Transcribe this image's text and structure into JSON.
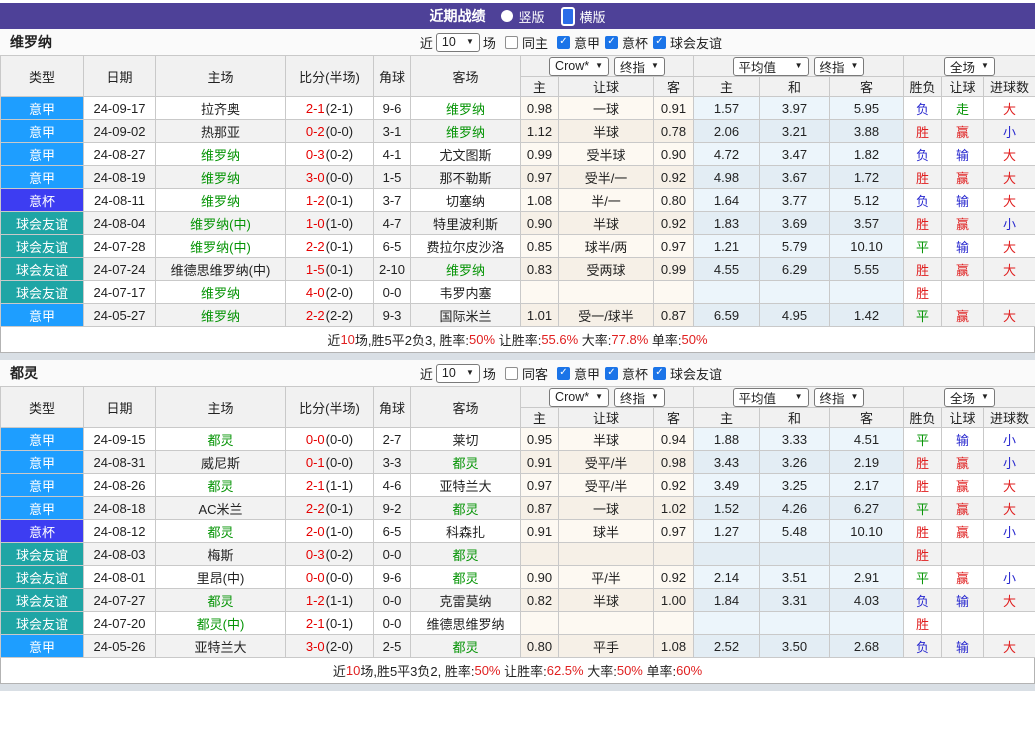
{
  "topbar": {
    "title": "近期战绩",
    "radios": [
      {
        "label": "竖版",
        "selected": false
      },
      {
        "label": "横版",
        "selected": true
      }
    ]
  },
  "table": {
    "left_headers": [
      "类型",
      "日期",
      "主场",
      "比分(半场)",
      "角球",
      "客场"
    ],
    "selects": {
      "crow": "Crow*",
      "fin1": "终指",
      "avg": "平均值",
      "fin2": "终指",
      "full": "全场"
    },
    "sub_headers": [
      "主",
      "让球",
      "客",
      "主",
      "和",
      "客",
      "胜负",
      "让球",
      "进球数"
    ]
  },
  "colors": {
    "topbar_bg": "#4e4198",
    "league": {
      "意甲": "#1e9eff",
      "意杯": "#3d3df2",
      "球会友谊": "#1fa5a5"
    },
    "result": {
      "r": "#e01f1f",
      "g": "#059405",
      "b": "#2828cf",
      "k": "#222222"
    },
    "team_highlight": "#059405",
    "score_ft": "#e60000",
    "score_ht": "#222222",
    "avg_col_bg": "#ecf5fb",
    "crow_col_bg": "#fdf9f2"
  },
  "teams": [
    {
      "name": "维罗纳",
      "controls": {
        "prefix": "近",
        "count": "10",
        "suffix": "场",
        "same_label": "同主",
        "same_checked": false,
        "filters": [
          {
            "label": "意甲",
            "checked": true
          },
          {
            "label": "意杯",
            "checked": true
          },
          {
            "label": "球会友谊",
            "checked": true
          }
        ]
      },
      "rows": [
        {
          "type": "意甲",
          "date": "24-09-17",
          "home": "拉齐奥",
          "home_hl": false,
          "ft": "2-1",
          "ht": "(2-1)",
          "corner": "9-6",
          "away": "维罗纳",
          "away_hl": true,
          "crow": [
            "0.98",
            "一球",
            "0.91"
          ],
          "avg": [
            "1.57",
            "3.97",
            "5.95"
          ],
          "res": [
            [
              "负",
              "b"
            ],
            [
              "走",
              "g"
            ],
            [
              "大",
              "r"
            ]
          ]
        },
        {
          "type": "意甲",
          "date": "24-09-02",
          "home": "热那亚",
          "home_hl": false,
          "ft": "0-2",
          "ht": "(0-0)",
          "corner": "3-1",
          "away": "维罗纳",
          "away_hl": true,
          "crow": [
            "1.12",
            "半球",
            "0.78"
          ],
          "avg": [
            "2.06",
            "3.21",
            "3.88"
          ],
          "res": [
            [
              "胜",
              "r"
            ],
            [
              "赢",
              "r"
            ],
            [
              "小",
              "b"
            ]
          ]
        },
        {
          "type": "意甲",
          "date": "24-08-27",
          "home": "维罗纳",
          "home_hl": true,
          "ft": "0-3",
          "ht": "(0-2)",
          "corner": "4-1",
          "away": "尤文图斯",
          "away_hl": false,
          "crow": [
            "0.99",
            "受半球",
            "0.90"
          ],
          "avg": [
            "4.72",
            "3.47",
            "1.82"
          ],
          "res": [
            [
              "负",
              "b"
            ],
            [
              "输",
              "b"
            ],
            [
              "大",
              "r"
            ]
          ]
        },
        {
          "type": "意甲",
          "date": "24-08-19",
          "home": "维罗纳",
          "home_hl": true,
          "ft": "3-0",
          "ht": "(0-0)",
          "corner": "1-5",
          "away": "那不勒斯",
          "away_hl": false,
          "crow": [
            "0.97",
            "受半/一",
            "0.92"
          ],
          "avg": [
            "4.98",
            "3.67",
            "1.72"
          ],
          "res": [
            [
              "胜",
              "r"
            ],
            [
              "赢",
              "r"
            ],
            [
              "大",
              "r"
            ]
          ]
        },
        {
          "type": "意杯",
          "date": "24-08-11",
          "home": "维罗纳",
          "home_hl": true,
          "ft": "1-2",
          "ht": "(0-1)",
          "corner": "3-7",
          "away": "切塞纳",
          "away_hl": false,
          "crow": [
            "1.08",
            "半/一",
            "0.80"
          ],
          "avg": [
            "1.64",
            "3.77",
            "5.12"
          ],
          "res": [
            [
              "负",
              "b"
            ],
            [
              "输",
              "b"
            ],
            [
              "大",
              "r"
            ]
          ]
        },
        {
          "type": "球会友谊",
          "date": "24-08-04",
          "home": "维罗纳(中)",
          "home_hl": true,
          "ft": "1-0",
          "ht": "(1-0)",
          "corner": "4-7",
          "away": "特里波利斯",
          "away_hl": false,
          "crow": [
            "0.90",
            "半球",
            "0.92"
          ],
          "avg": [
            "1.83",
            "3.69",
            "3.57"
          ],
          "res": [
            [
              "胜",
              "r"
            ],
            [
              "赢",
              "r"
            ],
            [
              "小",
              "b"
            ]
          ]
        },
        {
          "type": "球会友谊",
          "date": "24-07-28",
          "home": "维罗纳(中)",
          "home_hl": true,
          "ft": "2-2",
          "ht": "(0-1)",
          "corner": "6-5",
          "away": "费拉尔皮沙洛",
          "away_hl": false,
          "crow": [
            "0.85",
            "球半/两",
            "0.97"
          ],
          "avg": [
            "1.21",
            "5.79",
            "10.10"
          ],
          "res": [
            [
              "平",
              "g"
            ],
            [
              "输",
              "b"
            ],
            [
              "大",
              "r"
            ]
          ]
        },
        {
          "type": "球会友谊",
          "date": "24-07-24",
          "home": "维德思维罗纳(中)",
          "home_hl": false,
          "ft": "1-5",
          "ht": "(0-1)",
          "corner": "2-10",
          "away": "维罗纳",
          "away_hl": true,
          "crow": [
            "0.83",
            "受两球",
            "0.99"
          ],
          "avg": [
            "4.55",
            "6.29",
            "5.55"
          ],
          "res": [
            [
              "胜",
              "r"
            ],
            [
              "赢",
              "r"
            ],
            [
              "大",
              "r"
            ]
          ]
        },
        {
          "type": "球会友谊",
          "date": "24-07-17",
          "home": "维罗纳",
          "home_hl": true,
          "ft": "4-0",
          "ht": "(2-0)",
          "corner": "0-0",
          "away": "韦罗内塞",
          "away_hl": false,
          "crow": [
            "",
            "",
            ""
          ],
          "avg": [
            "",
            "",
            ""
          ],
          "res": [
            [
              "胜",
              "r"
            ],
            [
              "",
              ""
            ],
            [
              "",
              ""
            ]
          ]
        },
        {
          "type": "意甲",
          "date": "24-05-27",
          "home": "维罗纳",
          "home_hl": true,
          "ft": "2-2",
          "ht": "(2-2)",
          "corner": "9-3",
          "away": "国际米兰",
          "away_hl": false,
          "crow": [
            "1.01",
            "受一/球半",
            "0.87"
          ],
          "avg": [
            "6.59",
            "4.95",
            "1.42"
          ],
          "res": [
            [
              "平",
              "g"
            ],
            [
              "赢",
              "r"
            ],
            [
              "大",
              "r"
            ]
          ]
        }
      ],
      "summary": [
        [
          "近",
          "k"
        ],
        [
          "10",
          "r"
        ],
        [
          "场,胜5平2负3, 胜率:",
          "k"
        ],
        [
          "50%",
          "r"
        ],
        [
          " 让胜率:",
          "k"
        ],
        [
          "55.6%",
          "r"
        ],
        [
          " 大率:",
          "k"
        ],
        [
          "77.8%",
          "r"
        ],
        [
          " 单率:",
          "k"
        ],
        [
          "50%",
          "r"
        ]
      ]
    },
    {
      "name": "都灵",
      "controls": {
        "prefix": "近",
        "count": "10",
        "suffix": "场",
        "same_label": "同客",
        "same_checked": false,
        "filters": [
          {
            "label": "意甲",
            "checked": true
          },
          {
            "label": "意杯",
            "checked": true
          },
          {
            "label": "球会友谊",
            "checked": true
          }
        ]
      },
      "rows": [
        {
          "type": "意甲",
          "date": "24-09-15",
          "home": "都灵",
          "home_hl": true,
          "ft": "0-0",
          "ht": "(0-0)",
          "corner": "2-7",
          "away": "莱切",
          "away_hl": false,
          "crow": [
            "0.95",
            "半球",
            "0.94"
          ],
          "avg": [
            "1.88",
            "3.33",
            "4.51"
          ],
          "res": [
            [
              "平",
              "g"
            ],
            [
              "输",
              "b"
            ],
            [
              "小",
              "b"
            ]
          ]
        },
        {
          "type": "意甲",
          "date": "24-08-31",
          "home": "威尼斯",
          "home_hl": false,
          "ft": "0-1",
          "ht": "(0-0)",
          "corner": "3-3",
          "away": "都灵",
          "away_hl": true,
          "crow": [
            "0.91",
            "受平/半",
            "0.98"
          ],
          "avg": [
            "3.43",
            "3.26",
            "2.19"
          ],
          "res": [
            [
              "胜",
              "r"
            ],
            [
              "赢",
              "r"
            ],
            [
              "小",
              "b"
            ]
          ]
        },
        {
          "type": "意甲",
          "date": "24-08-26",
          "home": "都灵",
          "home_hl": true,
          "ft": "2-1",
          "ht": "(1-1)",
          "corner": "4-6",
          "away": "亚特兰大",
          "away_hl": false,
          "crow": [
            "0.97",
            "受平/半",
            "0.92"
          ],
          "avg": [
            "3.49",
            "3.25",
            "2.17"
          ],
          "res": [
            [
              "胜",
              "r"
            ],
            [
              "赢",
              "r"
            ],
            [
              "大",
              "r"
            ]
          ]
        },
        {
          "type": "意甲",
          "date": "24-08-18",
          "home": "AC米兰",
          "home_hl": false,
          "ft": "2-2",
          "ht": "(0-1)",
          "corner": "9-2",
          "away": "都灵",
          "away_hl": true,
          "crow": [
            "0.87",
            "一球",
            "1.02"
          ],
          "avg": [
            "1.52",
            "4.26",
            "6.27"
          ],
          "res": [
            [
              "平",
              "g"
            ],
            [
              "赢",
              "r"
            ],
            [
              "大",
              "r"
            ]
          ]
        },
        {
          "type": "意杯",
          "date": "24-08-12",
          "home": "都灵",
          "home_hl": true,
          "ft": "2-0",
          "ht": "(1-0)",
          "corner": "6-5",
          "away": "科森扎",
          "away_hl": false,
          "crow": [
            "0.91",
            "球半",
            "0.97"
          ],
          "avg": [
            "1.27",
            "5.48",
            "10.10"
          ],
          "res": [
            [
              "胜",
              "r"
            ],
            [
              "赢",
              "r"
            ],
            [
              "小",
              "b"
            ]
          ]
        },
        {
          "type": "球会友谊",
          "date": "24-08-03",
          "home": "梅斯",
          "home_hl": false,
          "ft": "0-3",
          "ht": "(0-2)",
          "corner": "0-0",
          "away": "都灵",
          "away_hl": true,
          "crow": [
            "",
            "",
            ""
          ],
          "avg": [
            "",
            "",
            ""
          ],
          "res": [
            [
              "胜",
              "r"
            ],
            [
              "",
              ""
            ],
            [
              "",
              ""
            ]
          ]
        },
        {
          "type": "球会友谊",
          "date": "24-08-01",
          "home": "里昂(中)",
          "home_hl": false,
          "ft": "0-0",
          "ht": "(0-0)",
          "corner": "9-6",
          "away": "都灵",
          "away_hl": true,
          "crow": [
            "0.90",
            "平/半",
            "0.92"
          ],
          "avg": [
            "2.14",
            "3.51",
            "2.91"
          ],
          "res": [
            [
              "平",
              "g"
            ],
            [
              "赢",
              "r"
            ],
            [
              "小",
              "b"
            ]
          ]
        },
        {
          "type": "球会友谊",
          "date": "24-07-27",
          "home": "都灵",
          "home_hl": true,
          "ft": "1-2",
          "ht": "(1-1)",
          "corner": "0-0",
          "away": "克雷莫纳",
          "away_hl": false,
          "crow": [
            "0.82",
            "半球",
            "1.00"
          ],
          "avg": [
            "1.84",
            "3.31",
            "4.03"
          ],
          "res": [
            [
              "负",
              "b"
            ],
            [
              "输",
              "b"
            ],
            [
              "大",
              "r"
            ]
          ]
        },
        {
          "type": "球会友谊",
          "date": "24-07-20",
          "home": "都灵(中)",
          "home_hl": true,
          "ft": "2-1",
          "ht": "(0-1)",
          "corner": "0-0",
          "away": "维德思维罗纳",
          "away_hl": false,
          "crow": [
            "",
            "",
            ""
          ],
          "avg": [
            "",
            "",
            ""
          ],
          "res": [
            [
              "胜",
              "r"
            ],
            [
              "",
              ""
            ],
            [
              "",
              ""
            ]
          ]
        },
        {
          "type": "意甲",
          "date": "24-05-26",
          "home": "亚特兰大",
          "home_hl": false,
          "ft": "3-0",
          "ht": "(2-0)",
          "corner": "2-5",
          "away": "都灵",
          "away_hl": true,
          "crow": [
            "0.80",
            "平手",
            "1.08"
          ],
          "avg": [
            "2.52",
            "3.50",
            "2.68"
          ],
          "res": [
            [
              "负",
              "b"
            ],
            [
              "输",
              "b"
            ],
            [
              "大",
              "r"
            ]
          ]
        }
      ],
      "summary": [
        [
          "近",
          "k"
        ],
        [
          "10",
          "r"
        ],
        [
          "场,胜5平3负2, 胜率:",
          "k"
        ],
        [
          "50%",
          "r"
        ],
        [
          " 让胜率:",
          "k"
        ],
        [
          "62.5%",
          "r"
        ],
        [
          " 大率:",
          "k"
        ],
        [
          "50%",
          "r"
        ],
        [
          " 单率:",
          "k"
        ],
        [
          "60%",
          "r"
        ]
      ]
    }
  ]
}
